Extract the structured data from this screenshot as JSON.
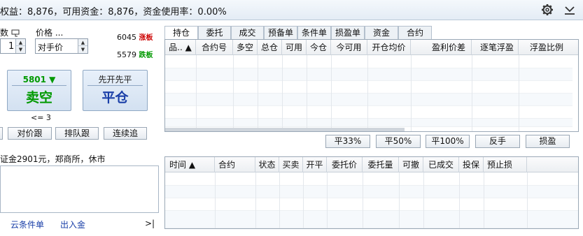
{
  "topbar": {
    "summary": "权益：8,876，可用资金：8,876，资金使用率：0.00%",
    "icons": [
      "gear-icon",
      "download-icon"
    ]
  },
  "order": {
    "qty_label_prefix": "数",
    "price_label": "价格 ...",
    "qty_value": "1",
    "price_value": "对手价",
    "limit_up_price": "6045",
    "limit_up_label": "涨板",
    "limit_down_price": "5579",
    "limit_down_label": "跌板",
    "sell_short": {
      "price": "5801",
      "label": "卖空"
    },
    "close": {
      "top_label": "先开先平",
      "label": "平仓"
    },
    "qty_hint": "<= 3",
    "buttons": [
      "对价跟",
      "排队跟",
      "连续追"
    ],
    "info_text": "证金2901元，郑商所，休市",
    "links": [
      "云条件单",
      "出入金"
    ],
    "collapse_glyph": ">|"
  },
  "tabs": [
    "持仓",
    "委托",
    "成交",
    "预备单",
    "条件单",
    "损盈单",
    "资金",
    "合约"
  ],
  "positions_table": {
    "columns": [
      "品.. ▲",
      "合约号",
      "多空",
      "总仓",
      "可用",
      "今仓",
      "今可用",
      "开仓均价",
      "盈利价差",
      "逐笔浮盈",
      "浮盈比例"
    ]
  },
  "actions": [
    "平33%",
    "平50%",
    "平100%",
    "反手",
    "损盈"
  ],
  "orders_table": {
    "columns": [
      "时间 ▲",
      "合约",
      "状态",
      "买卖",
      "开平",
      "委托价",
      "委托量",
      "可撤",
      "已成交",
      "投保",
      "预止损"
    ]
  },
  "colors": {
    "accent": "#1a3fa8",
    "up": "#cc0000",
    "down": "#009900"
  }
}
